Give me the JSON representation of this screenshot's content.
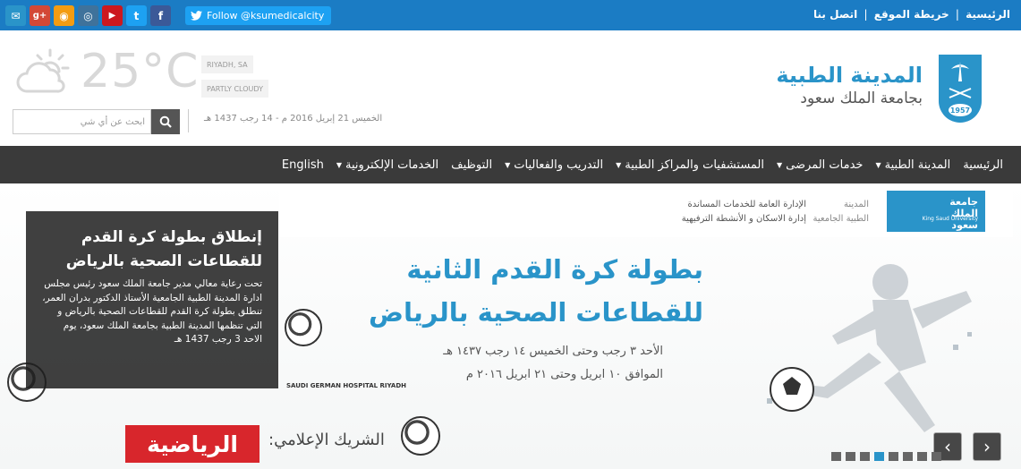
{
  "topbar": {
    "social": [
      {
        "name": "email",
        "glyph": "✉",
        "color": "#2a94c9"
      },
      {
        "name": "google-plus",
        "glyph": "g+",
        "color": "#d34836"
      },
      {
        "name": "rss",
        "glyph": "◉",
        "color": "#f39c12"
      },
      {
        "name": "instagram",
        "glyph": "◎",
        "color": "#3f729b"
      },
      {
        "name": "youtube",
        "glyph": "▶",
        "color": "#cc181e"
      },
      {
        "name": "twitter",
        "glyph": "t",
        "color": "#1da1f2"
      },
      {
        "name": "facebook",
        "glyph": "f",
        "color": "#3b5998"
      }
    ],
    "follow_label": "Follow @ksumedicalcity",
    "links": [
      "الرئيسية",
      "خريطة الموقع",
      "اتصل بنا"
    ],
    "separator": "|"
  },
  "header": {
    "logo_title": "المدينة الطبية",
    "logo_subtitle": "بجامعة الملك سعود",
    "emblem_year": "1957",
    "weather": {
      "temperature": "25°C",
      "location": "RIYADH, SA",
      "condition": "PARTLY CLOUDY"
    },
    "search_placeholder": "ابحث عن أي شي",
    "date": "الخميس 21 إبريل 2016 م - 14 رجب 1437 هـ"
  },
  "nav": {
    "items": [
      {
        "label": "الرئيسية",
        "dropdown": false
      },
      {
        "label": "المدينة الطبية",
        "dropdown": true
      },
      {
        "label": "خدمات المرضى",
        "dropdown": true
      },
      {
        "label": "المستشفيات والمراكز الطبية",
        "dropdown": true
      },
      {
        "label": "التدريب والفعاليات",
        "dropdown": true
      },
      {
        "label": "التوظيف",
        "dropdown": false
      },
      {
        "label": "الخدمات الإلكترونية",
        "dropdown": true
      },
      {
        "label": "English",
        "dropdown": false
      }
    ]
  },
  "banner": {
    "ksu_logo_ar": "جامعة الملك سعود",
    "ksu_logo_en": "King Saud University",
    "medcity_ar_1": "المدينة",
    "medcity_ar_2": "الطبية الجامعية",
    "admin_line1": "الإدارة العامة للخدمات المساندة",
    "admin_line2": "إدارة الاسكان و الأنشطة الترفيهية",
    "headline_line1": "بطولة كرة القدم الثانية",
    "headline_line2": "للقطاعات الصحية بالرياض",
    "date_line1": "الأحد ٣ رجب وحتى الخميس ١٤ رجب ١٤٣٧ هـ",
    "date_line2": "الموافق ١٠ ابريل وحتى ٢١ ابريل ٢٠١٦ م",
    "sponsor_hospital": "SAUDI GERMAN HOSPITAL RIYADH",
    "partner_label": "الشريك الإعلامي:",
    "partner_name": "الرياضية",
    "overlay_title": "إنطلاق بطولة كرة القدم للقطاعات الصحية بالرياض",
    "overlay_body": "تحت رعاية معالي مدير جامعة الملك سعود رئيس مجلس ادارة المدينة الطبية الجامعية الأستاذ الدكتور بدران العمر، تنطلق بطولة كرة القدم للقطاعات الصحية بالرياض و التي تنظمها المدينة الطبية بجامعة الملك سعود، يوم الاحد 3 رجب 1437 هـ",
    "prev_arrow": "‹",
    "next_arrow": "›",
    "slide_count": 8,
    "active_slide": 4
  }
}
